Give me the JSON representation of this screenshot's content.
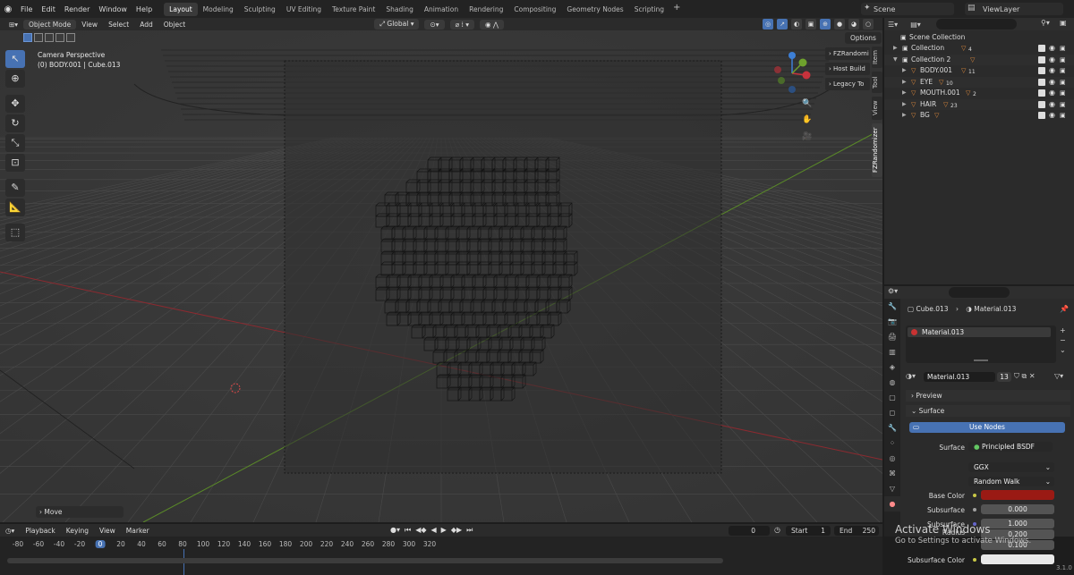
{
  "menu": {
    "items": [
      "File",
      "Edit",
      "Render",
      "Window",
      "Help"
    ],
    "workspaces": [
      "Layout",
      "Modeling",
      "Sculpting",
      "UV Editing",
      "Texture Paint",
      "Shading",
      "Animation",
      "Rendering",
      "Compositing",
      "Geometry Nodes",
      "Scripting"
    ],
    "active_workspace": "Layout",
    "add_tab": "+",
    "scene": "Scene",
    "view_layer": "ViewLayer"
  },
  "viewport_header": {
    "mode": "Object Mode",
    "menus": [
      "View",
      "Select",
      "Add",
      "Object"
    ],
    "transform_orientation": "Global",
    "options": "Options"
  },
  "viewport": {
    "camera_label": "Camera Perspective",
    "object_label": "(0) BODY.001 | Cube.013",
    "last_op": "Move",
    "npanel_buttons": [
      "FZRandomi",
      "Host Build",
      "Legacy To"
    ],
    "vertical_tabs": [
      "Item",
      "Tool",
      "View",
      "FZRandomizer"
    ],
    "gizmo_axes": [
      "X",
      "Y",
      "Z"
    ]
  },
  "outliner": {
    "root": "Scene Collection",
    "rows": [
      {
        "name": "Collection",
        "indent": 1,
        "badge": "4"
      },
      {
        "name": "Collection 2",
        "indent": 1,
        "badge": ""
      },
      {
        "name": "BODY.001",
        "indent": 2,
        "badge": "11"
      },
      {
        "name": "EYE",
        "indent": 2,
        "badge": "10"
      },
      {
        "name": "MOUTH.001",
        "indent": 2,
        "badge": "2"
      },
      {
        "name": "HAIR",
        "indent": 2,
        "badge": "23"
      },
      {
        "name": "BG",
        "indent": 2,
        "badge": ""
      }
    ]
  },
  "properties": {
    "breadcrumb_object": "Cube.013",
    "breadcrumb_material": "Material.013",
    "slot_name": "Material.013",
    "material_name": "Material.013",
    "user_count": "13",
    "sections": {
      "preview": "Preview",
      "surface": "Surface"
    },
    "use_nodes": "Use Nodes",
    "surface_label": "Surface",
    "surface_value": "Principled BSDF",
    "distribution": "GGX",
    "subsurface_method": "Random Walk",
    "base_color_label": "Base Color",
    "base_color": "#9a1a14",
    "subsurface_label": "Subsurface",
    "subsurface_value": "0.000",
    "subsurface_radius_label": "Subsurface Radius",
    "subsurface_radius": [
      "1.000",
      "0.200",
      "0.100"
    ],
    "subsurface_color_label": "Subsurface Color"
  },
  "timeline": {
    "menus": [
      "Playback",
      "Keying",
      "View",
      "Marker"
    ],
    "current_frame": "0",
    "start_label": "Start",
    "start": "1",
    "end_label": "End",
    "end": "250",
    "ticks": [
      "-80",
      "-60",
      "-40",
      "-20",
      "0",
      "20",
      "40",
      "60",
      "80",
      "100",
      "120",
      "140",
      "160",
      "180",
      "200",
      "220",
      "240",
      "260",
      "280",
      "300",
      "320"
    ]
  },
  "watermark": {
    "title": "Activate Windows",
    "subtitle": "Go to Settings to activate Windows."
  },
  "version": "3.1.0",
  "colors": {
    "accent": "#4772b3",
    "x_axis": "#c8323c",
    "y_axis": "#6ea12d",
    "z_axis": "#3d7fd6"
  }
}
